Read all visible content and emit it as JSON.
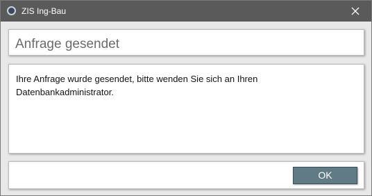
{
  "window": {
    "title": "ZIS Ing-Bau",
    "app_icon": "circle-app-icon",
    "close_icon": "close-icon",
    "titlebar_color": "#5a5a5a"
  },
  "header": {
    "title": "Anfrage gesendet"
  },
  "body": {
    "message": "Ihre Anfrage wurde gesendet, bitte wenden Sie sich an Ihren Datenbankadministrator."
  },
  "footer": {
    "ok_label": "OK",
    "ok_color": "#607a86"
  }
}
